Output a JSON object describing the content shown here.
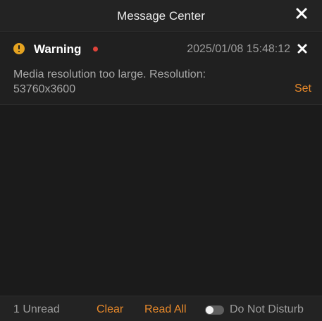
{
  "window": {
    "title": "Message Center",
    "close_icon": "close-icon"
  },
  "messages": [
    {
      "icon": "warning-icon",
      "type": "Warning",
      "unread": true,
      "unread_dot_color": "#e0433a",
      "timestamp": "2025/01/08 15:48:12",
      "body": "Media resolution too large. Resolution: 53760x3600",
      "action_label": "Set",
      "close_icon": "close-icon"
    }
  ],
  "footer": {
    "unread_text": "1 Unread",
    "clear_label": "Clear",
    "read_all_label": "Read All",
    "do_not_disturb_label": "Do Not Disturb",
    "do_not_disturb_enabled": false
  },
  "colors": {
    "accent": "#e8892a",
    "warning": "#e5a321",
    "background": "#1b1b1b"
  }
}
